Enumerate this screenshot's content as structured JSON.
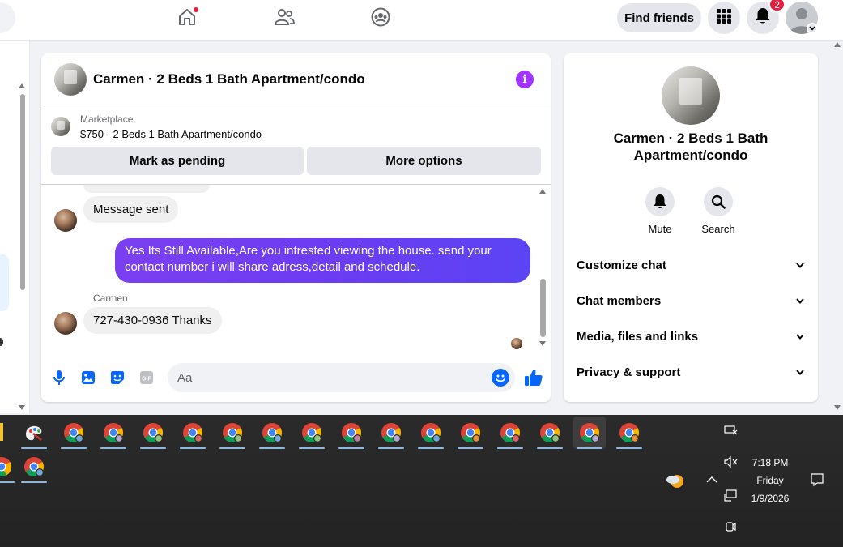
{
  "topbar": {
    "find_friends_label": "Find friends",
    "notifications_count": "2"
  },
  "chat": {
    "title": "Carmen · 2 Beds 1 Bath Apartment/condo",
    "marketplace_label": "Marketplace",
    "listing": "$750 - 2 Beds 1 Bath Apartment/condo",
    "mark_pending_label": "Mark as pending",
    "more_options_label": "More options",
    "messages": {
      "message_sent": "Message sent",
      "outgoing": "Yes Its Still Available,Are you intrested viewing the house. send your contact number i will share adress,detail and schedule.",
      "sender_name": "Carmen",
      "reply": "727-430-0936 Thanks"
    },
    "composer_placeholder": "Aa"
  },
  "details": {
    "title": "Carmen · 2 Beds 1 Bath Apartment/condo",
    "actions": [
      {
        "label": "Mute",
        "icon": "bell-icon"
      },
      {
        "label": "Search",
        "icon": "search-icon"
      }
    ],
    "sections": [
      {
        "label": "Customize chat"
      },
      {
        "label": "Chat members"
      },
      {
        "label": "Media, files and links"
      },
      {
        "label": "Privacy & support"
      }
    ]
  },
  "taskbar": {
    "time": "7:18 PM",
    "day": "Friday",
    "date": "1/9/2026"
  },
  "colors": {
    "messenger_purple": "#7b3ff0",
    "facebook_blue": "#0866ff",
    "badge_red": "#e41e3f",
    "info_purple": "#a033ff"
  }
}
